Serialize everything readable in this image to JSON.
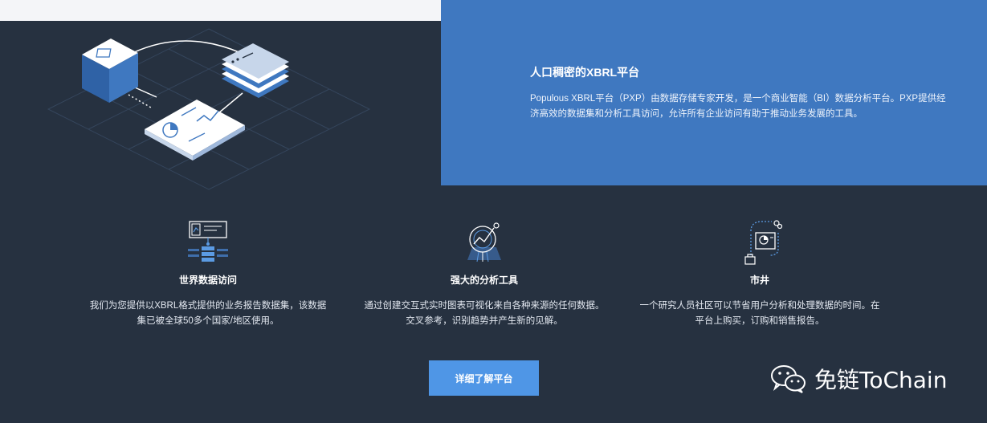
{
  "hero": {
    "title": "人口稠密的XBRL平台",
    "description": "Populous XBRL平台（PXP）由数据存储专家开发，是一个商业智能（BI）数据分析平台。PXP提供经济高效的数据集和分析工具访问，允许所有企业访问有助于推动业务发展的工具。"
  },
  "features": [
    {
      "icon": "global-data-icon",
      "title": "世界数据访问",
      "description": "我们为您提供以XBRL格式提供的业务报告数据集，该数据集已被全球50多个国家/地区使用。"
    },
    {
      "icon": "analytics-chart-icon",
      "title": "强大的分析工具",
      "description": "通过创建交互式实时图表可视化来自各种来源的任何数据。交叉参考，识别趋势并产生新的见解。"
    },
    {
      "icon": "marketplace-icon",
      "title": "市井",
      "description": "一个研究人员社区可以节省用户分析和处理数据的时间。在平台上购买，订购和销售报告。"
    }
  ],
  "cta": {
    "label": "详细了解平台"
  },
  "watermark": {
    "text": "免链ToChain",
    "icon": "wechat-icon"
  },
  "colors": {
    "background": "#263140",
    "panel": "#3f78c0",
    "button": "#4f96e6",
    "top_strip": "#f4f5f8"
  }
}
